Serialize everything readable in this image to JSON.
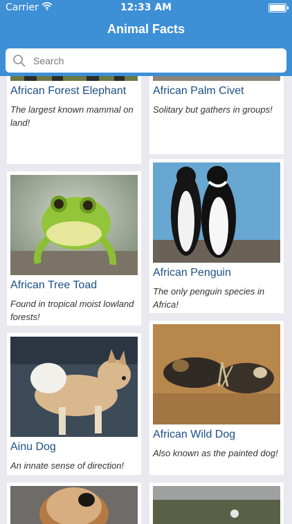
{
  "status": {
    "carrier": "Carrier",
    "time": "12:33 AM"
  },
  "header": {
    "title": "Animal Facts"
  },
  "search": {
    "placeholder": "Search"
  },
  "cards": [
    {
      "name": "African Forest Elephant",
      "fact": "The largest known mammal on land!"
    },
    {
      "name": "African Palm Civet",
      "fact": "Solitary but gathers in groups!"
    },
    {
      "name": "African Tree Toad",
      "fact": "Found in tropical moist lowland forests!"
    },
    {
      "name": "African Penguin",
      "fact": "The only penguin species in Africa!"
    },
    {
      "name": "Ainu Dog",
      "fact": "An innate sense of direction!"
    },
    {
      "name": "African Wild Dog",
      "fact": "Also known as the painted dog!"
    }
  ],
  "colors": {
    "header": "#3d8fd6",
    "name": "#1b4f86",
    "background": "#e9e9ef"
  }
}
